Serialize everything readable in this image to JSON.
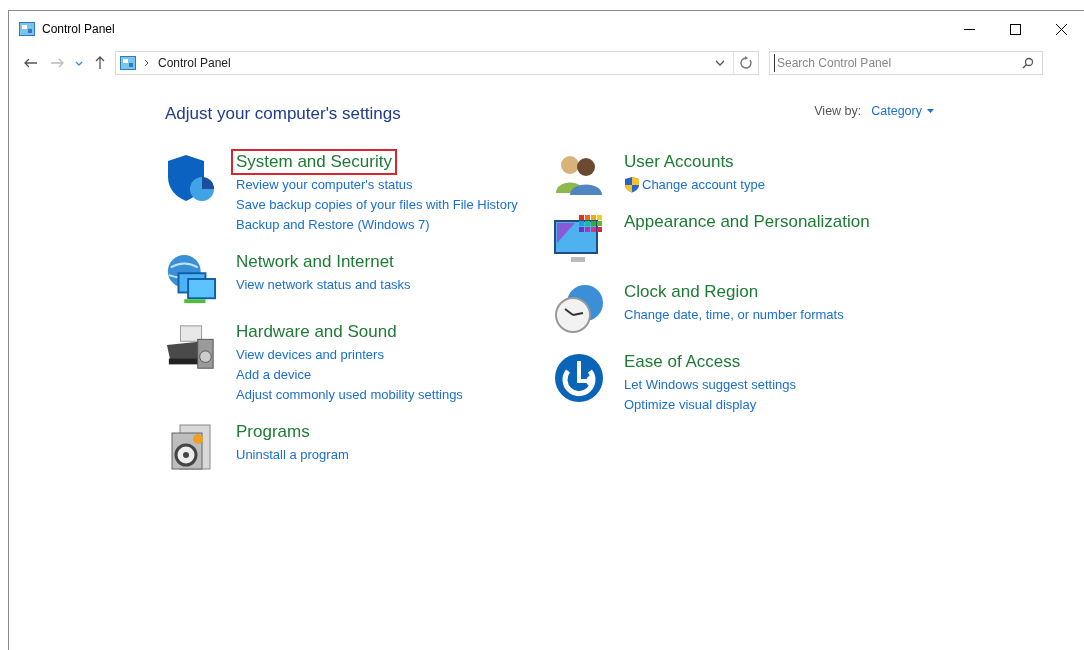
{
  "window": {
    "title": "Control Panel"
  },
  "address_bar": {
    "path": "Control Panel"
  },
  "search": {
    "placeholder": "Search Control Panel"
  },
  "heading": "Adjust your computer's settings",
  "view_by": {
    "label": "View by:",
    "value": "Category"
  },
  "columns": [
    [
      {
        "kind": "shield",
        "title": "System and Security",
        "highlighted": true,
        "links": [
          {
            "text": "Review your computer's status"
          },
          {
            "text": "Save backup copies of your files with File History"
          },
          {
            "text": "Backup and Restore (Windows 7)"
          }
        ]
      },
      {
        "kind": "network",
        "title": "Network and Internet",
        "highlighted": false,
        "links": [
          {
            "text": "View network status and tasks"
          }
        ]
      },
      {
        "kind": "hardware",
        "title": "Hardware and Sound",
        "highlighted": false,
        "links": [
          {
            "text": "View devices and printers"
          },
          {
            "text": "Add a device"
          },
          {
            "text": "Adjust commonly used mobility settings"
          }
        ]
      },
      {
        "kind": "programs",
        "title": "Programs",
        "highlighted": false,
        "links": [
          {
            "text": "Uninstall a program"
          }
        ]
      }
    ],
    [
      {
        "kind": "users",
        "title": "User Accounts",
        "highlighted": false,
        "links": [
          {
            "text": "Change account type",
            "shield": true
          }
        ]
      },
      {
        "kind": "appearance",
        "title": "Appearance and Personalization",
        "highlighted": false
      },
      {
        "kind": "clock",
        "title": "Clock and Region",
        "highlighted": false,
        "links": [
          {
            "text": "Change date, time, or number formats"
          }
        ]
      },
      {
        "kind": "ease",
        "title": "Ease of Access",
        "highlighted": false,
        "links": [
          {
            "text": "Let Windows suggest settings"
          },
          {
            "text": "Optimize visual display"
          }
        ]
      }
    ]
  ]
}
